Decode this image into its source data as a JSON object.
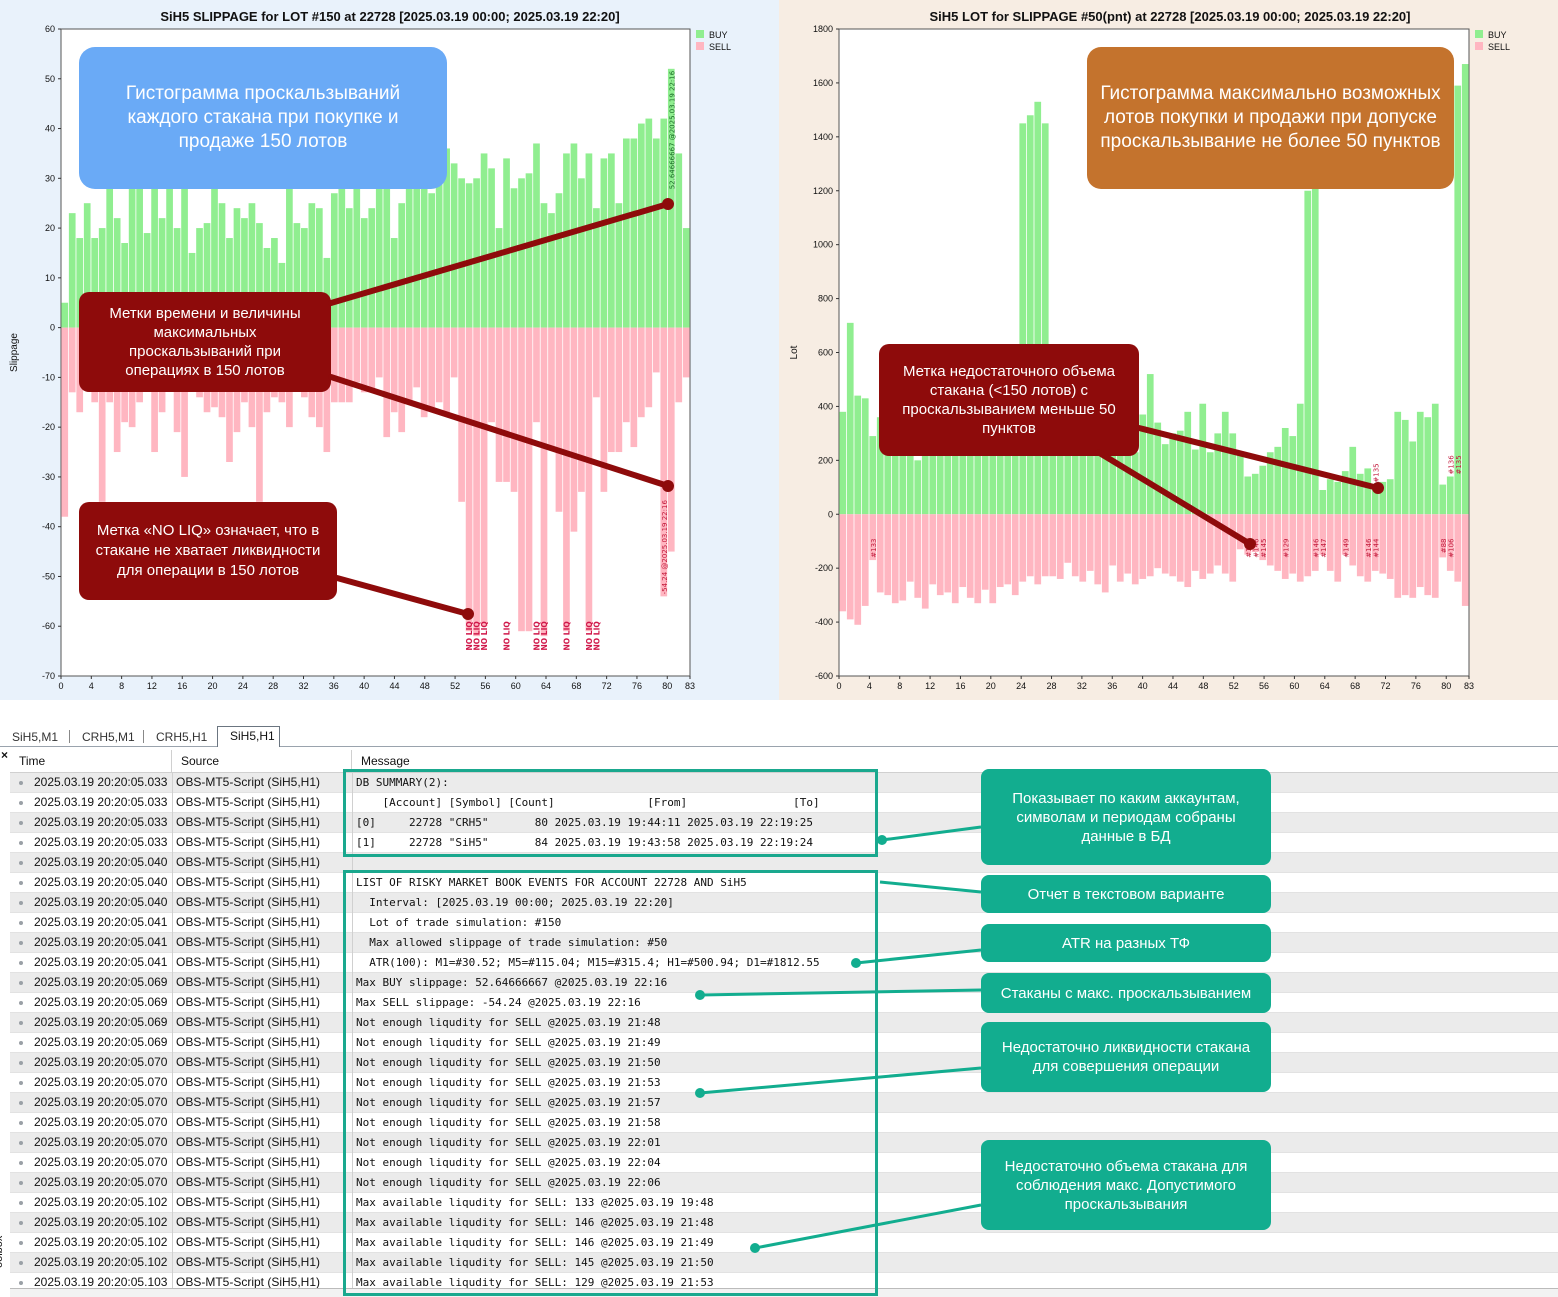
{
  "chart_data": [
    {
      "type": "bar",
      "title": "SiH5 SLIPPAGE for LOT #150 at 22728 [2025.03.19 00:00; 2025.03.19 22:20]",
      "xlabel": "",
      "ylabel": "Slippage",
      "xlim": [
        0,
        83
      ],
      "ylim": [
        -70,
        60
      ],
      "x_ticks": [
        "0",
        "4",
        "8",
        "12",
        "16",
        "20",
        "24",
        "28",
        "32",
        "36",
        "40",
        "44",
        "48",
        "52",
        "56",
        "60",
        "64",
        "68",
        "72",
        "76",
        "80",
        "83"
      ],
      "y_ticks": [
        "60",
        "50",
        "40",
        "30",
        "20",
        "10",
        "0",
        "-10",
        "-20",
        "-30",
        "-40",
        "-50",
        "-60",
        "-70"
      ],
      "legend": [
        "BUY",
        "SELL"
      ],
      "legend_position": "top-right",
      "colors": {
        "BUY": "#90ee90",
        "SELL": "#ffb6c1"
      },
      "series": [
        {
          "name": "BUY",
          "values": [
            5,
            23,
            18,
            25,
            18,
            20,
            30,
            22,
            17,
            28,
            30,
            19,
            34,
            22,
            34,
            20,
            38,
            15,
            20,
            21,
            36,
            25,
            18,
            24,
            22,
            25,
            21,
            16,
            18,
            13,
            30,
            21,
            20,
            25,
            24,
            14,
            27,
            34,
            24,
            32,
            22,
            24,
            30,
            33,
            18,
            25,
            31,
            35,
            30,
            27,
            36,
            36,
            33,
            30,
            29,
            30,
            35,
            32,
            20,
            34,
            28,
            30,
            31,
            37,
            25,
            23,
            27,
            35,
            37,
            30,
            35,
            24,
            34,
            35,
            25,
            38,
            38,
            41,
            42,
            38,
            42,
            52,
            35,
            20
          ]
        },
        {
          "name": "SELL",
          "values": [
            -38,
            -13,
            -17,
            -12,
            -15,
            -35,
            -15,
            -25,
            -19,
            -20,
            -15,
            -12,
            -25,
            -17,
            -12,
            -21,
            -30,
            -10,
            -14,
            -17,
            -16,
            -18,
            -27,
            -21,
            -15,
            -20,
            -35,
            -17,
            -14,
            -15,
            -20,
            -11,
            -14,
            -18,
            -20,
            -25,
            -15,
            -15,
            -15,
            -11,
            -13,
            -13,
            -10,
            -22,
            -17,
            -21,
            -15,
            -12,
            -18,
            -16,
            -15,
            -17,
            -10,
            -35,
            -61,
            -62,
            -60,
            -19,
            -31,
            -31,
            -33,
            -61,
            -61,
            -19,
            -62,
            -24,
            -37,
            -61,
            -41,
            -33,
            -61,
            -14,
            -33,
            -25,
            -25,
            -19,
            -24,
            -18,
            -16,
            -9,
            -54,
            -45,
            -15,
            -10
          ]
        }
      ],
      "annotations": {
        "max_buy_label": "52.64666667 @2025.03.19 22:16",
        "max_sell_label": "-54.24 @2025.03.19 22:16",
        "no_liq_label": "NO LIQ",
        "no_liq_x": [
          54,
          55,
          56,
          59,
          63,
          64,
          67,
          70,
          71
        ]
      }
    },
    {
      "type": "bar",
      "title": "SiH5 LOT for SLIPPAGE #50(pnt) at 22728 [2025.03.19 00:00; 2025.03.19 22:20]",
      "xlabel": "",
      "ylabel": "Lot",
      "xlim": [
        0,
        83
      ],
      "ylim": [
        -600,
        1800
      ],
      "x_ticks": [
        "0",
        "4",
        "8",
        "12",
        "16",
        "20",
        "24",
        "28",
        "32",
        "36",
        "40",
        "44",
        "48",
        "52",
        "56",
        "60",
        "64",
        "68",
        "72",
        "76",
        "80",
        "83"
      ],
      "y_ticks": [
        "1800",
        "1600",
        "1400",
        "1200",
        "1000",
        "800",
        "600",
        "400",
        "200",
        "0",
        "-200",
        "-400",
        "-600"
      ],
      "legend": [
        "BUY",
        "SELL"
      ],
      "legend_position": "top-right",
      "colors": {
        "BUY": "#90ee90",
        "SELL": "#ffb6c1"
      },
      "series": [
        {
          "name": "BUY",
          "values": [
            380,
            710,
            440,
            430,
            290,
            360,
            280,
            350,
            250,
            310,
            200,
            320,
            280,
            320,
            480,
            280,
            390,
            280,
            230,
            300,
            250,
            350,
            320,
            360,
            1450,
            1480,
            1530,
            1450,
            290,
            280,
            320,
            520,
            360,
            310,
            300,
            280,
            360,
            280,
            300,
            230,
            370,
            520,
            340,
            260,
            300,
            310,
            380,
            240,
            410,
            230,
            300,
            380,
            300,
            230,
            140,
            150,
            180,
            230,
            250,
            320,
            290,
            410,
            1200,
            1660,
            90,
            130,
            120,
            160,
            250,
            150,
            170,
            110,
            120,
            130,
            380,
            350,
            270,
            380,
            360,
            410,
            110,
            140,
            1590,
            1670
          ]
        },
        {
          "name": "SELL",
          "values": [
            -360,
            -390,
            -410,
            -340,
            -170,
            -290,
            -300,
            -330,
            -320,
            -250,
            -310,
            -350,
            -260,
            -300,
            -290,
            -330,
            -270,
            -310,
            -330,
            -280,
            -330,
            -270,
            -260,
            -300,
            -250,
            -230,
            -260,
            -230,
            -230,
            -240,
            -180,
            -230,
            -250,
            -210,
            -260,
            -290,
            -190,
            -250,
            -220,
            -260,
            -240,
            -230,
            -200,
            -220,
            -230,
            -250,
            -270,
            -210,
            -240,
            -220,
            -190,
            -220,
            -250,
            -130,
            -150,
            -140,
            -170,
            -190,
            -210,
            -240,
            -220,
            -250,
            -230,
            -210,
            -150,
            -210,
            -250,
            -150,
            -190,
            -230,
            -250,
            -210,
            -220,
            -240,
            -310,
            -300,
            -310,
            -270,
            -300,
            -310,
            -160,
            -210,
            -250,
            -340
          ]
        }
      ],
      "annotations": {
        "buy_tags": [
          {
            "x": 71,
            "text": "#135"
          },
          {
            "x": 81,
            "text": "#136"
          },
          {
            "x": 82,
            "text": "#135"
          }
        ],
        "sell_tags": [
          {
            "x": 4,
            "text": "#133"
          },
          {
            "x": 54,
            "text": "#146"
          },
          {
            "x": 55,
            "text": "#146"
          },
          {
            "x": 56,
            "text": "#145"
          },
          {
            "x": 59,
            "text": "#129"
          },
          {
            "x": 63,
            "text": "#146"
          },
          {
            "x": 64,
            "text": "#147"
          },
          {
            "x": 67,
            "text": "#149"
          },
          {
            "x": 70,
            "text": "#146"
          },
          {
            "x": 71,
            "text": "#144"
          },
          {
            "x": 80,
            "text": "#88"
          },
          {
            "x": 81,
            "text": "#106"
          }
        ]
      }
    }
  ],
  "notes": {
    "hist1": "Гистограмма проскальзываний каждого стакана при покупке и продаже 150 лотов",
    "hist2": "Гистограмма максимально возможных лотов покупки и продажи при допуске проскальзывание не более 50 пунктов",
    "time_labels": "Метки времени и величины максимальных проскальзываний при операциях в 150 лотов",
    "no_liq": "Метка «NO LIQ» означает, что в стакане не хватает ликвидности для операции в 150 лотов",
    "low_volume": "Метка недостаточного объема стакана (<150 лотов) с проскальзыванием меньше 50 пунктов"
  },
  "terminal": {
    "tabs": [
      "SiH5,M1",
      "CRH5,M1",
      "CRH5,H1",
      "SiH5,H1"
    ],
    "active_tab": 3,
    "close": "×",
    "toolbox": "oolbox",
    "columns": [
      "Time",
      "Source",
      "Message"
    ],
    "rows": [
      {
        "time": "2025.03.19 20:20:05.033",
        "source": "OBS-MT5-Script (SiH5,H1)",
        "message": "DB SUMMARY(2):"
      },
      {
        "time": "2025.03.19 20:20:05.033",
        "source": "OBS-MT5-Script (SiH5,H1)",
        "message": "    [Account] [Symbol] [Count]              [From]                [To]"
      },
      {
        "time": "2025.03.19 20:20:05.033",
        "source": "OBS-MT5-Script (SiH5,H1)",
        "message": "[0]     22728 \"CRH5\"       80 2025.03.19 19:44:11 2025.03.19 22:19:25"
      },
      {
        "time": "2025.03.19 20:20:05.033",
        "source": "OBS-MT5-Script (SiH5,H1)",
        "message": "[1]     22728 \"SiH5\"       84 2025.03.19 19:43:58 2025.03.19 22:19:24"
      },
      {
        "time": "2025.03.19 20:20:05.040",
        "source": "OBS-MT5-Script (SiH5,H1)",
        "message": ""
      },
      {
        "time": "2025.03.19 20:20:05.040",
        "source": "OBS-MT5-Script (SiH5,H1)",
        "message": "LIST OF RISKY MARKET BOOK EVENTS FOR ACCOUNT 22728 AND SiH5"
      },
      {
        "time": "2025.03.19 20:20:05.040",
        "source": "OBS-MT5-Script (SiH5,H1)",
        "message": "  Interval: [2025.03.19 00:00; 2025.03.19 22:20]"
      },
      {
        "time": "2025.03.19 20:20:05.041",
        "source": "OBS-MT5-Script (SiH5,H1)",
        "message": "  Lot of trade simulation: #150"
      },
      {
        "time": "2025.03.19 20:20:05.041",
        "source": "OBS-MT5-Script (SiH5,H1)",
        "message": "  Max allowed slippage of trade simulation: #50"
      },
      {
        "time": "2025.03.19 20:20:05.041",
        "source": "OBS-MT5-Script (SiH5,H1)",
        "message": "  ATR(100): M1=#30.52; M5=#115.04; M15=#315.4; H1=#500.94; D1=#1812.55"
      },
      {
        "time": "2025.03.19 20:20:05.069",
        "source": "OBS-MT5-Script (SiH5,H1)",
        "message": "Max BUY slippage: 52.64666667 @2025.03.19 22:16"
      },
      {
        "time": "2025.03.19 20:20:05.069",
        "source": "OBS-MT5-Script (SiH5,H1)",
        "message": "Max SELL slippage: -54.24 @2025.03.19 22:16"
      },
      {
        "time": "2025.03.19 20:20:05.069",
        "source": "OBS-MT5-Script (SiH5,H1)",
        "message": "Not enough liqudity for SELL @2025.03.19 21:48"
      },
      {
        "time": "2025.03.19 20:20:05.069",
        "source": "OBS-MT5-Script (SiH5,H1)",
        "message": "Not enough liqudity for SELL @2025.03.19 21:49"
      },
      {
        "time": "2025.03.19 20:20:05.070",
        "source": "OBS-MT5-Script (SiH5,H1)",
        "message": "Not enough liqudity for SELL @2025.03.19 21:50"
      },
      {
        "time": "2025.03.19 20:20:05.070",
        "source": "OBS-MT5-Script (SiH5,H1)",
        "message": "Not enough liqudity for SELL @2025.03.19 21:53"
      },
      {
        "time": "2025.03.19 20:20:05.070",
        "source": "OBS-MT5-Script (SiH5,H1)",
        "message": "Not enough liqudity for SELL @2025.03.19 21:57"
      },
      {
        "time": "2025.03.19 20:20:05.070",
        "source": "OBS-MT5-Script (SiH5,H1)",
        "message": "Not enough liqudity for SELL @2025.03.19 21:58"
      },
      {
        "time": "2025.03.19 20:20:05.070",
        "source": "OBS-MT5-Script (SiH5,H1)",
        "message": "Not enough liqudity for SELL @2025.03.19 22:01"
      },
      {
        "time": "2025.03.19 20:20:05.070",
        "source": "OBS-MT5-Script (SiH5,H1)",
        "message": "Not enough liqudity for SELL @2025.03.19 22:04"
      },
      {
        "time": "2025.03.19 20:20:05.070",
        "source": "OBS-MT5-Script (SiH5,H1)",
        "message": "Not enough liqudity for SELL @2025.03.19 22:06"
      },
      {
        "time": "2025.03.19 20:20:05.102",
        "source": "OBS-MT5-Script (SiH5,H1)",
        "message": "Max available liqudity for SELL: 133 @2025.03.19 19:48"
      },
      {
        "time": "2025.03.19 20:20:05.102",
        "source": "OBS-MT5-Script (SiH5,H1)",
        "message": "Max available liqudity for SELL: 146 @2025.03.19 21:48"
      },
      {
        "time": "2025.03.19 20:20:05.102",
        "source": "OBS-MT5-Script (SiH5,H1)",
        "message": "Max available liqudity for SELL: 146 @2025.03.19 21:49"
      },
      {
        "time": "2025.03.19 20:20:05.102",
        "source": "OBS-MT5-Script (SiH5,H1)",
        "message": "Max available liqudity for SELL: 145 @2025.03.19 21:50"
      },
      {
        "time": "2025.03.19 20:20:05.103",
        "source": "OBS-MT5-Script (SiH5,H1)",
        "message": "Max available liqudity for SELL: 129 @2025.03.19 21:53"
      }
    ],
    "notes": {
      "summary": "Показывает по каким аккаунтам, символам и периодам собраны данные в БД",
      "text_report": "Отчет в текстовом варианте",
      "atr": "ATR на разных ТФ",
      "max_slippage": "Стаканы с макс. проскальзыванием",
      "no_liquidity": "Недостаточно ликвидности стакана для совершения операции",
      "low_volume": "Недостаточно объема стакана для соблюдения макс. Допустимого проскальзывания"
    }
  }
}
